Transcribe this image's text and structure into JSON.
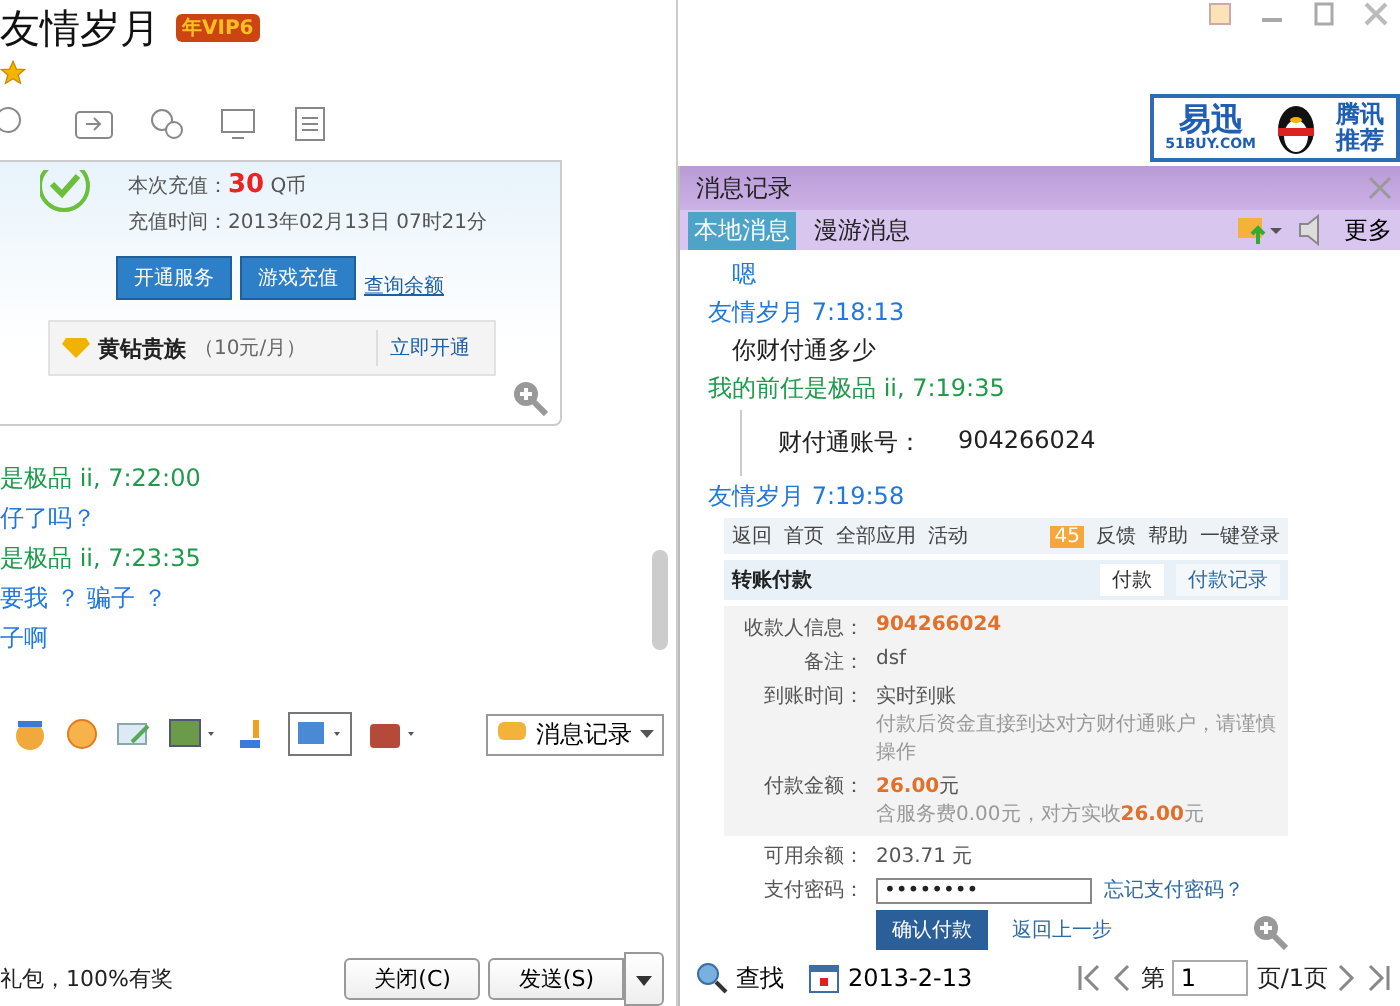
{
  "window": {
    "title": "友情岁月",
    "vip_badge": "年VIP6"
  },
  "ad": {
    "brand": "易迅",
    "domain": "51BUY.COM",
    "line1": "腾讯",
    "line2": "推荐"
  },
  "recharge_card": {
    "amount_label": "本次充值：",
    "amount": "30",
    "amount_unit": "Q币",
    "time": "充值时间：2013年02月13日  07时21分",
    "buttons": [
      "开通服务",
      "游戏充值"
    ],
    "link": "查询余额",
    "promo_name": "黄钻贵族",
    "promo_price": "（10元/月）",
    "promo_button": "立即开通"
  },
  "chat": [
    {
      "kind": "peer_header",
      "text": "是极品 ii,  7:22:00"
    },
    {
      "kind": "text",
      "color": "#1e78e0",
      "text": "仔了吗？"
    },
    {
      "kind": "peer_header",
      "text": "是极品 ii,  7:23:35"
    },
    {
      "kind": "text",
      "color": "#1e78e0",
      "text": "要我 ？ 骗子 ？"
    },
    {
      "kind": "text",
      "color": "#1e78e0",
      "text": "子啊"
    }
  ],
  "input_toolbar": {
    "history_button": "消息记录"
  },
  "footer": {
    "promo": "礼包，100%有奖",
    "close_button": "关闭(C)",
    "send_button": "发送(S)"
  },
  "history": {
    "title": "消息记录",
    "tabs": [
      {
        "label": "本地消息",
        "selected": true
      },
      {
        "label": "漫游消息",
        "selected": false
      }
    ],
    "more": "更多",
    "messages": [
      {
        "kind": "text",
        "color": "#1e78e0",
        "text": "嗯"
      },
      {
        "kind": "self_header",
        "text": "友情岁月 7:18:13"
      },
      {
        "kind": "text",
        "color": "#222222",
        "text": "你财付通多少"
      },
      {
        "kind": "peer_header",
        "text": "我的前任是极品 ii, 7:19:35"
      },
      {
        "kind": "quote",
        "label": "财付通账号：",
        "value": "904266024"
      },
      {
        "kind": "self_header",
        "text": "友情岁月 7:19:58"
      },
      {
        "kind": "payment"
      }
    ],
    "payment": {
      "nav": [
        "返回",
        "首页",
        "全部应用",
        "活动"
      ],
      "badge": "45",
      "nav_right": [
        "反馈",
        "帮助",
        "一键登录"
      ],
      "title": "转账付款",
      "tabs": [
        {
          "label": "付款",
          "selected": true
        },
        {
          "label": "付款记录",
          "selected": false
        }
      ],
      "rows": [
        {
          "label": "收款人信息：",
          "value": "904266024",
          "highlight": true
        },
        {
          "label": "备注：",
          "value": "dsf",
          "highlight": false
        },
        {
          "label": "到账时间：",
          "value": "实时到账",
          "hint": "付款后资金直接到达对方财付通账户，请谨慎操作",
          "highlight": false
        },
        {
          "label": "付款金额：",
          "value": "26.00",
          "unit": "元",
          "hint": "含服务费0.00元，对方实收",
          "hint_value": "26.00",
          "hint_unit": "元",
          "highlight": true
        }
      ],
      "balance_label": "可用余额：",
      "balance": "203.71 元",
      "password_label": "支付密码：",
      "password": "••••••••",
      "forgot": "忘记支付密码？",
      "confirm": "确认付款",
      "back": "返回上一步"
    },
    "search": "查找",
    "date": "2013-2-13",
    "page_prefix": "第",
    "page": "1",
    "page_suffix": "页/1页"
  }
}
